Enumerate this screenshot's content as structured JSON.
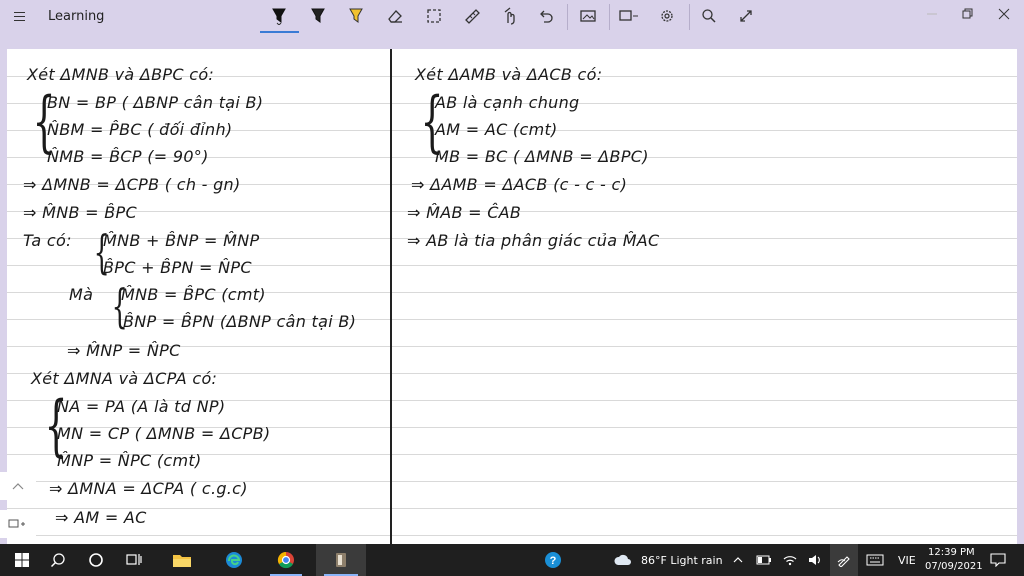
{
  "app": {
    "title": "Learning"
  },
  "toolbar": {
    "tools": [
      {
        "name": "pen-black-icon"
      },
      {
        "name": "pen-dark-icon"
      },
      {
        "name": "highlighter-icon"
      },
      {
        "name": "eraser-icon"
      },
      {
        "name": "lasso-select-icon"
      },
      {
        "name": "ruler-icon"
      },
      {
        "name": "touch-writing-icon"
      },
      {
        "name": "undo-icon"
      },
      {
        "name": "add-image-icon"
      },
      {
        "name": "shapes-icon"
      },
      {
        "name": "settings-icon"
      },
      {
        "name": "search-icon"
      },
      {
        "name": "expand-icon"
      }
    ],
    "colors": {
      "accent": "#3a7bd5",
      "highlighter": "#f2c12e",
      "titlebar": "#d9d2ea"
    }
  },
  "notes": {
    "left": [
      "Xét ΔMNB và ΔBPC có:",
      "BN = BP ( ΔBNP cân tại B)",
      "N̂BM = P̂BC ( đối đỉnh)",
      "N̂MB = B̂CP (= 90°)",
      "⇒ ΔMNB = ΔCPB ( ch - gn)",
      "⇒ M̂NB = B̂PC",
      "Ta có:",
      "M̂NB + B̂NP = M̂NP",
      "B̂PC + B̂PN = N̂PC",
      "Mà",
      "M̂NB = B̂PC (cmt)",
      "B̂NP = B̂PN (ΔBNP cân tại B)",
      "⇒ M̂NP = N̂PC",
      "Xét ΔMNA và ΔCPA có:",
      "NA = PA (A là td NP)",
      "MN = CP ( ΔMNB = ΔCPB)",
      "M̂NP = N̂PC (cmt)",
      "⇒ ΔMNA = ΔCPA ( c.g.c)",
      "⇒ AM = AC"
    ],
    "right": [
      "Xét ΔAMB và ΔACB có:",
      "AB là cạnh chung",
      "AM = AC (cmt)",
      "MB = BC ( ΔMNB = ΔBPC)",
      "⇒ ΔAMB = ΔACB (c - c - c)",
      "⇒ M̂AB = ĈAB",
      "⇒ AB là tia phân giác của M̂AC"
    ]
  },
  "taskbar": {
    "weather": "86°F  Light rain",
    "language": "VIE",
    "time": "12:39 PM",
    "date": "07/09/2021"
  }
}
